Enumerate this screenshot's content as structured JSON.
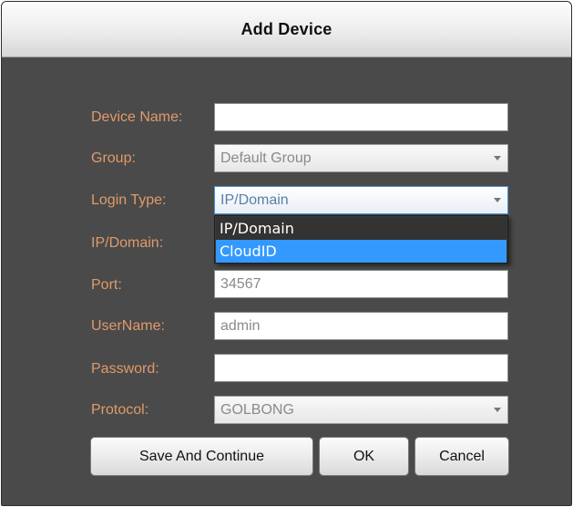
{
  "dialog": {
    "title": "Add Device"
  },
  "form": {
    "device_name": {
      "label": "Device Name:",
      "value": ""
    },
    "group": {
      "label": "Group:",
      "value": "Default Group"
    },
    "login_type": {
      "label": "Login Type:",
      "value": "IP/Domain"
    },
    "ip_domain": {
      "label": "IP/Domain:"
    },
    "port": {
      "label": "Port:",
      "value": "34567"
    },
    "username": {
      "label": "UserName:",
      "value": "admin"
    },
    "password": {
      "label": "Password:",
      "value": ""
    },
    "protocol": {
      "label": "Protocol:",
      "value": "GOLBONG"
    }
  },
  "login_type_dropdown": {
    "options": [
      "IP/Domain",
      "CloudID"
    ],
    "highlighted": "CloudID"
  },
  "buttons": {
    "save_continue": "Save And Continue",
    "ok": "OK",
    "cancel": "Cancel"
  },
  "colors": {
    "label": "#e09a6a",
    "background": "#4a4a4a",
    "highlight": "#3399ff",
    "focus_border": "#4a90d9"
  }
}
